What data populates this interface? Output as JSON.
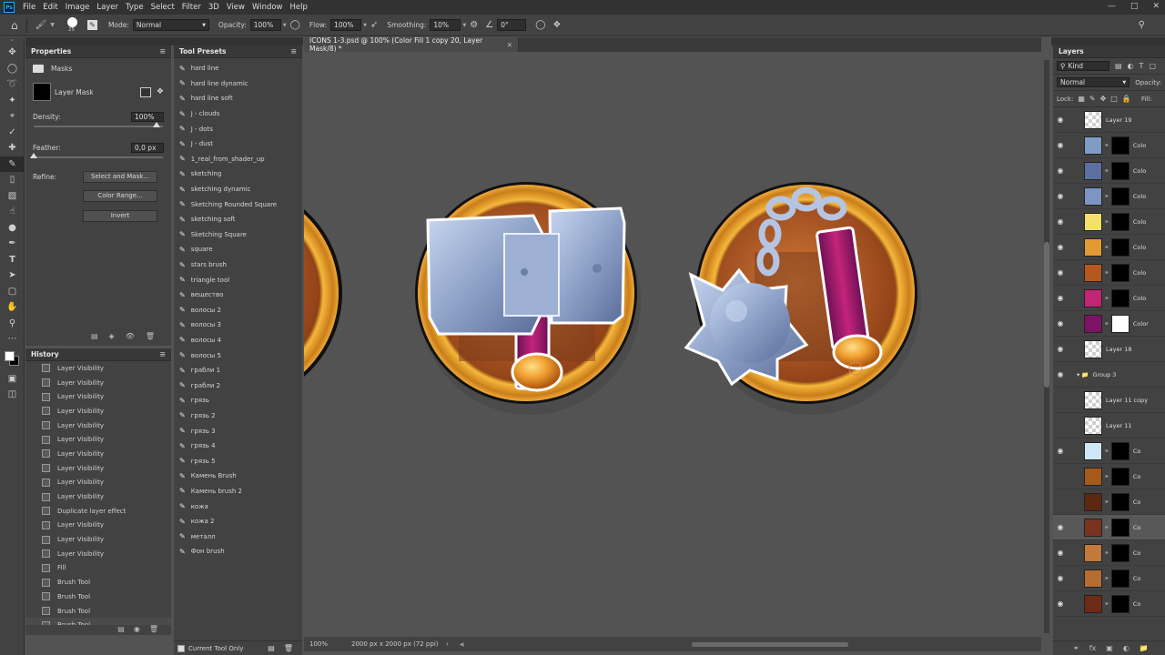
{
  "menubar": {
    "logo": "Ps",
    "items": [
      "File",
      "Edit",
      "Image",
      "Layer",
      "Type",
      "Select",
      "Filter",
      "3D",
      "View",
      "Window",
      "Help"
    ]
  },
  "options": {
    "brush_size": "25",
    "mode_label": "Mode:",
    "mode_value": "Normal",
    "opacity_label": "Opacity:",
    "opacity_value": "100%",
    "flow_label": "Flow:",
    "flow_value": "100%",
    "smoothing_label": "Smoothing:",
    "smoothing_value": "10%",
    "angle_value": "0°"
  },
  "properties": {
    "title": "Properties",
    "section": "Masks",
    "mask_type": "Layer Mask",
    "density_label": "Density:",
    "density_value": "100%",
    "feather_label": "Feather:",
    "feather_value": "0,0 px",
    "refine_label": "Refine:",
    "btn_select_mask": "Select and Mask...",
    "btn_color_range": "Color Range...",
    "btn_invert": "Invert"
  },
  "history": {
    "title": "History",
    "items": [
      "Layer Visibility",
      "Layer Visibility",
      "Layer Visibility",
      "Layer Visibility",
      "Layer Visibility",
      "Layer Visibility",
      "Layer Visibility",
      "Layer Visibility",
      "Layer Visibility",
      "Layer Visibility",
      "Duplicate layer effect",
      "Layer Visibility",
      "Layer Visibility",
      "Layer Visibility",
      "Fill",
      "Brush Tool",
      "Brush Tool",
      "Brush Tool",
      "Brush Tool"
    ]
  },
  "presets": {
    "title": "Tool Presets",
    "items": [
      "hard line",
      "hard line dynamic",
      "hard line soft",
      "J - clouds",
      "J - dots",
      "J - dust",
      "1_real_from_shader_up",
      "sketching",
      "sketching dynamic",
      "Sketching Rounded Square",
      "sketching soft",
      "Sketching Square",
      "square",
      "stars brush",
      "triangle tool",
      "вещество",
      "волосы 2",
      "волосы 3",
      "волосы 4",
      "волосы 5",
      "грабли 1",
      "грабли 2",
      "грязь",
      "грязь 2",
      "грязь 3",
      "грязь 4",
      "грязь 5",
      "Камень Brush",
      "Камень brush 2",
      "кожа",
      "кожа 2",
      "металл",
      "Фон brush"
    ],
    "current_only": "Current Tool Only"
  },
  "document": {
    "tab_title": "ICONS 1-3.psd @ 100% (Color Fill 1 copy 20, Layer Mask/8) *",
    "zoom": "100%",
    "doc_size": "2000 px x 2000 px (72 ppi)"
  },
  "layers": {
    "title": "Layers",
    "kind_label": "Kind",
    "blend_mode": "Normal",
    "opacity_label": "Opacity:",
    "lock_label": "Lock:",
    "fill_label": "Fill:",
    "rows": [
      {
        "name": "Layer 19",
        "color": "checker",
        "mask": "none",
        "eye": true
      },
      {
        "name": "Colo",
        "color": "#7e9cc4",
        "mask": "#000",
        "eye": true
      },
      {
        "name": "Colo",
        "color": "#5c6fa0",
        "mask": "#000",
        "eye": true
      },
      {
        "name": "Colo",
        "color": "#7d95c4",
        "mask": "#000",
        "eye": true
      },
      {
        "name": "Colo",
        "color": "#f2e069",
        "mask": "#000",
        "eye": true
      },
      {
        "name": "Colo",
        "color": "#e49a33",
        "mask": "#000",
        "eye": true
      },
      {
        "name": "Colo",
        "color": "#b5581d",
        "mask": "#000",
        "eye": true
      },
      {
        "name": "Colo",
        "color": "#c42474",
        "mask": "#000",
        "eye": true
      },
      {
        "name": "Color",
        "color": "#7e1265",
        "mask": "#fff",
        "eye": true
      },
      {
        "name": "Layer 18",
        "color": "checker",
        "mask": "none",
        "eye": true
      },
      {
        "name": "Group 3",
        "color": "group",
        "mask": "none",
        "eye": true
      },
      {
        "name": "Layer 11 copy",
        "color": "checker",
        "mask": "none",
        "eye": false
      },
      {
        "name": "Layer 11",
        "color": "checker",
        "mask": "none",
        "eye": false
      },
      {
        "name": "Co",
        "color": "#cfe7f5",
        "mask": "#000",
        "eye": true
      },
      {
        "name": "Co",
        "color": "#a55a19",
        "mask": "#000",
        "eye": false
      },
      {
        "name": "Co",
        "color": "#5b2812",
        "mask": "#000",
        "eye": false
      },
      {
        "name": "Co",
        "color": "#7a3221",
        "mask": "#000",
        "eye": true
      },
      {
        "name": "Co",
        "color": "#c17a3c",
        "mask": "#000",
        "eye": true
      },
      {
        "name": "Co",
        "color": "#b56d32",
        "mask": "#000",
        "eye": true
      },
      {
        "name": "Co",
        "color": "#6d2a15",
        "mask": "#000",
        "eye": true
      }
    ]
  }
}
